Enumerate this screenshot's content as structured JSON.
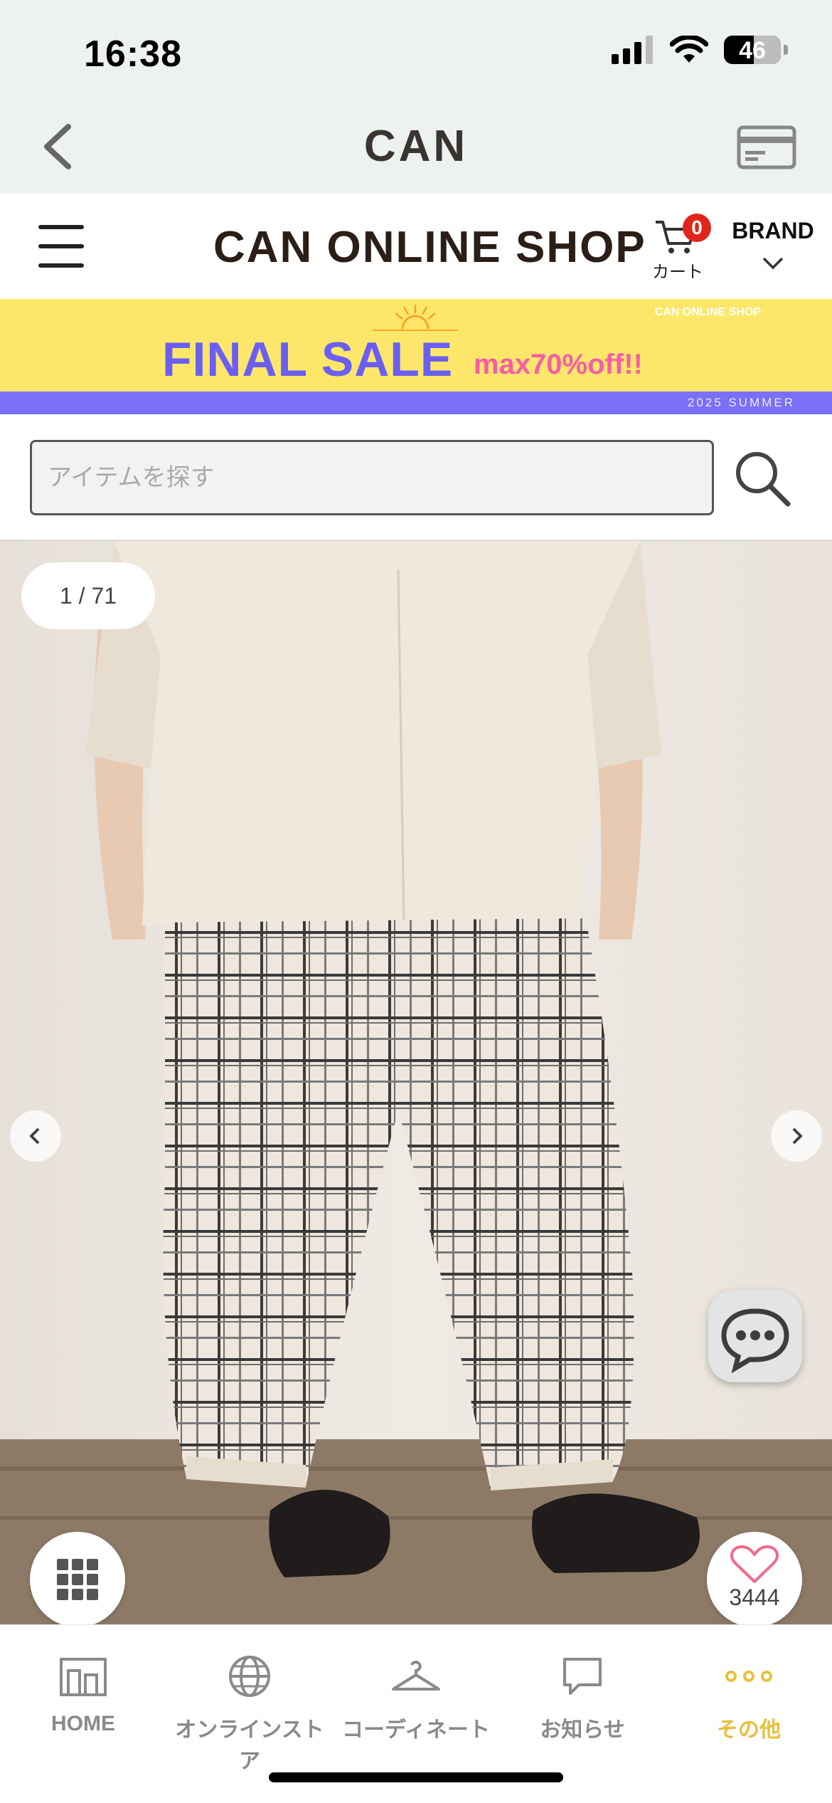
{
  "status_bar": {
    "time": "16:38",
    "battery": "46"
  },
  "app_header": {
    "logo": "CAN"
  },
  "shop_header": {
    "title": "CAN ONLINE SHOP",
    "cart_label": "カート",
    "cart_count": "0",
    "brand_label": "BRAND"
  },
  "banner": {
    "shop": "CAN ONLINE SHOP",
    "headline": "FINAL SALE",
    "sub": "max70%off!!",
    "season": "2025 SUMMER"
  },
  "search": {
    "placeholder": "アイテムを探す"
  },
  "product": {
    "image_counter": "1 / 71",
    "favorite_count": "3444"
  },
  "tabbar": {
    "items": [
      {
        "label": "HOME",
        "icon": "home-icon"
      },
      {
        "label": "オンラインストア",
        "icon": "globe-icon"
      },
      {
        "label": "コーディネート",
        "icon": "hanger-icon"
      },
      {
        "label": "お知らせ",
        "icon": "chat-bubble-icon"
      },
      {
        "label": "その他",
        "icon": "more-dots-icon"
      }
    ],
    "active": "その他"
  },
  "colors": {
    "mint_bg": "#edf2f0",
    "banner_yellow": "#fde76a",
    "banner_purple": "#7a6ff5",
    "banner_pink": "#f75da8",
    "badge_red": "#e1251b",
    "active_tab": "#e8c03d"
  }
}
